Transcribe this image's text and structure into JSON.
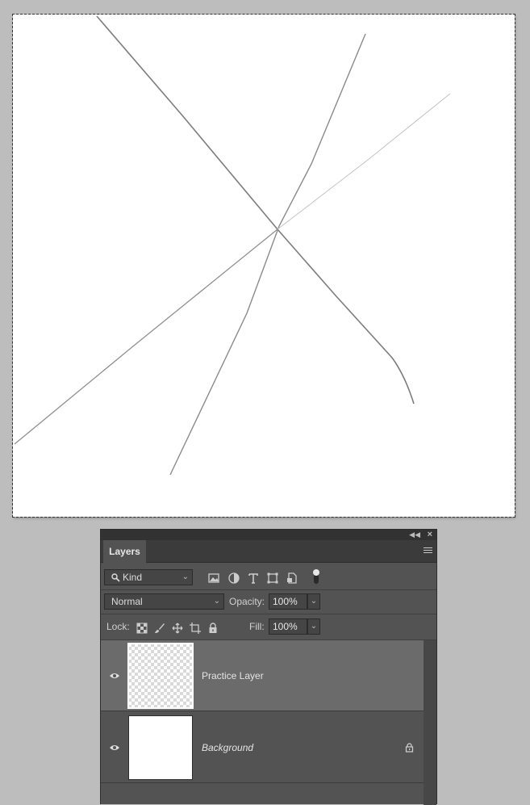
{
  "layers_panel": {
    "tab_label": "Layers",
    "filter": {
      "kind_label": "Kind"
    },
    "blend_mode": "Normal",
    "opacity_label": "Opacity:",
    "opacity_value": "100%",
    "lock_label": "Lock:",
    "fill_label": "Fill:",
    "fill_value": "100%",
    "layers": [
      {
        "name": "Practice Layer",
        "selected": true,
        "visible": true
      },
      {
        "name": "Background",
        "selected": false,
        "visible": true,
        "locked": true
      }
    ]
  },
  "colors": {
    "canvas_bg": "#ffffff",
    "workspace_bg": "#bdbdbd",
    "panel_bg": "#535353",
    "selected_layer": "#6b6b6b",
    "stroke": "#8a8a8a"
  }
}
